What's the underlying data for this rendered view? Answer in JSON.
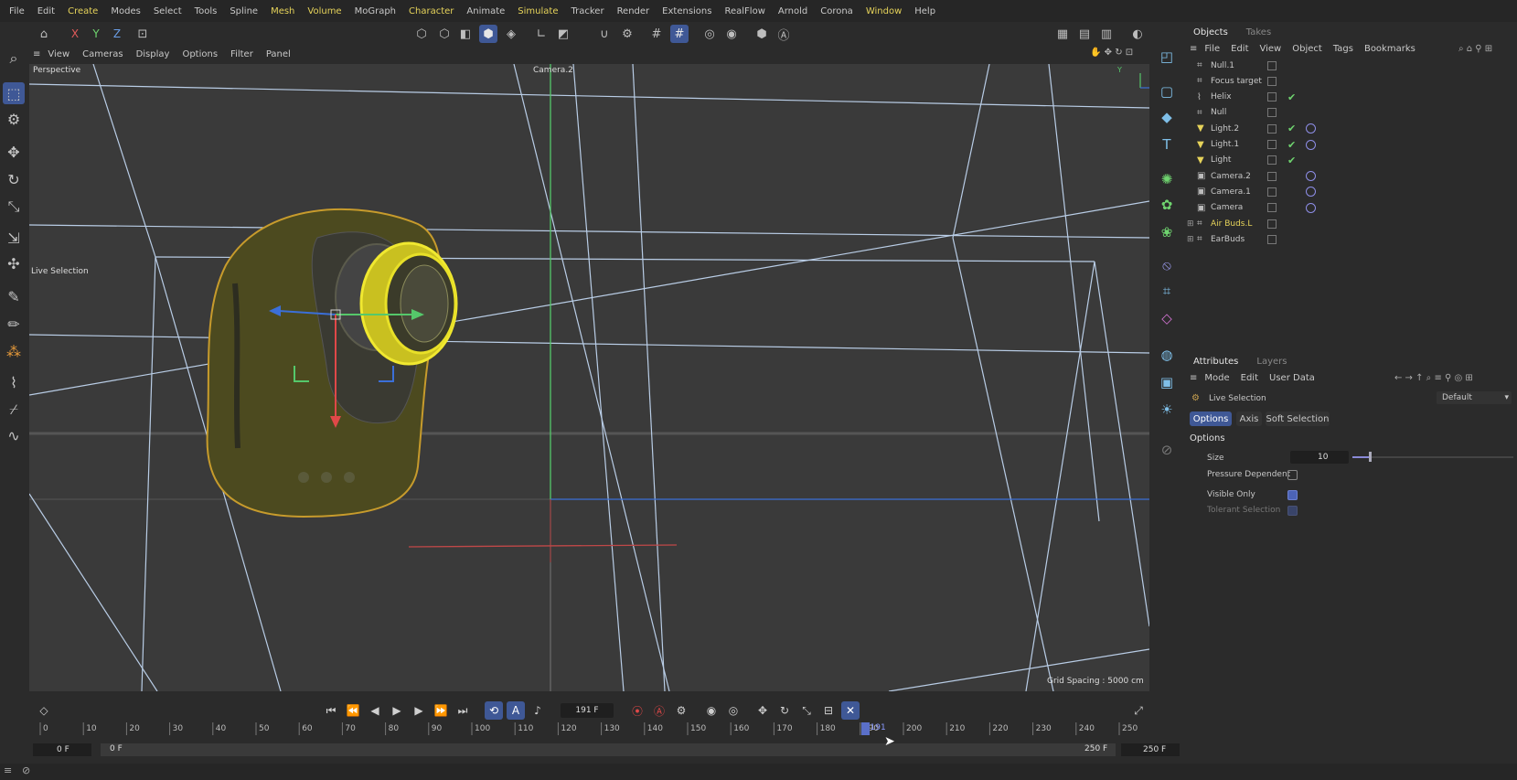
{
  "menubar": {
    "items": [
      {
        "label": "File",
        "highlight": false
      },
      {
        "label": "Edit",
        "highlight": false
      },
      {
        "label": "Create",
        "highlight": true
      },
      {
        "label": "Modes",
        "highlight": false
      },
      {
        "label": "Select",
        "highlight": false
      },
      {
        "label": "Tools",
        "highlight": false
      },
      {
        "label": "Spline",
        "highlight": false
      },
      {
        "label": "Mesh",
        "highlight": true
      },
      {
        "label": "Volume",
        "highlight": true
      },
      {
        "label": "MoGraph",
        "highlight": false
      },
      {
        "label": "Character",
        "highlight": true
      },
      {
        "label": "Animate",
        "highlight": false
      },
      {
        "label": "Simulate",
        "highlight": true
      },
      {
        "label": "Tracker",
        "highlight": false
      },
      {
        "label": "Render",
        "highlight": false
      },
      {
        "label": "Extensions",
        "highlight": false
      },
      {
        "label": "RealFlow",
        "highlight": false
      },
      {
        "label": "Arnold",
        "highlight": false
      },
      {
        "label": "Corona",
        "highlight": false
      },
      {
        "label": "Window",
        "highlight": true
      },
      {
        "label": "Help",
        "highlight": false
      }
    ]
  },
  "toolbar": {
    "axis_x": "X",
    "axis_y": "Y",
    "axis_z": "Z"
  },
  "viewport": {
    "menu": [
      "View",
      "Cameras",
      "Display",
      "Options",
      "Filter",
      "Panel"
    ],
    "view_label": "Perspective",
    "camera_label": "Camera.2",
    "tool_label": "Live Selection",
    "grid_spacing": "Grid Spacing : 5000 cm",
    "axis_y": "Y"
  },
  "objects": {
    "tabs": [
      "Objects",
      "Takes"
    ],
    "menu": [
      "File",
      "Edit",
      "View",
      "Object",
      "Tags",
      "Bookmarks"
    ],
    "rows": [
      {
        "name": "Null.1",
        "icon": "null-icon",
        "check": false,
        "tag": false,
        "highlight": false
      },
      {
        "name": "Focus target",
        "icon": "null-icon",
        "check": false,
        "tag": false,
        "highlight": false
      },
      {
        "name": "Helix",
        "icon": "spline-icon",
        "check": true,
        "tag": false,
        "highlight": false
      },
      {
        "name": "Null",
        "icon": "null-icon",
        "check": false,
        "tag": false,
        "highlight": false
      },
      {
        "name": "Light.2",
        "icon": "light-icon",
        "check": true,
        "tag": true,
        "highlight": false
      },
      {
        "name": "Light.1",
        "icon": "light-icon",
        "check": true,
        "tag": true,
        "highlight": false
      },
      {
        "name": "Light",
        "icon": "light-icon",
        "check": true,
        "tag": false,
        "highlight": false
      },
      {
        "name": "Camera.2",
        "icon": "camera-icon",
        "check": false,
        "tag": true,
        "highlight": false
      },
      {
        "name": "Camera.1",
        "icon": "camera-icon",
        "check": false,
        "tag": true,
        "highlight": false
      },
      {
        "name": "Camera",
        "icon": "camera-icon",
        "check": false,
        "tag": true,
        "highlight": false
      },
      {
        "name": "Air Buds.L",
        "icon": "null-icon",
        "check": false,
        "tag": false,
        "highlight": true
      },
      {
        "name": "EarBuds",
        "icon": "null-icon",
        "check": false,
        "tag": false,
        "highlight": false
      }
    ]
  },
  "attributes": {
    "tabs": [
      "Attributes",
      "Layers"
    ],
    "menu": [
      "Mode",
      "Edit",
      "User Data"
    ],
    "tool_name": "Live Selection",
    "preset": "Default",
    "subtabs": [
      "Options",
      "Axis",
      "Soft Selection"
    ],
    "section": "Options",
    "size_label": "Size",
    "size_value": "10",
    "size_fraction": 0.1,
    "pressure_label": "Pressure Dependent",
    "pressure_checked": false,
    "visible_label": "Visible Only",
    "visible_checked": true,
    "tolerant_label": "Tolerant Selection",
    "tolerant_checked": true
  },
  "timeline": {
    "current_frame": "191 F",
    "ruler_labels": [
      "0",
      "10",
      "20",
      "30",
      "40",
      "50",
      "60",
      "70",
      "80",
      "90",
      "100",
      "110",
      "120",
      "130",
      "140",
      "150",
      "160",
      "170",
      "180",
      "190",
      "200",
      "210",
      "220",
      "230",
      "240",
      "250"
    ],
    "playhead_label": "191",
    "start_frame": "0 F",
    "range_start": "0 F",
    "range_end": "250 F",
    "end_frame": "250 F"
  },
  "colors": {
    "accent": "#3f5896",
    "highlight_yellow": "#e6d35a",
    "check_green": "#6fd46f"
  }
}
